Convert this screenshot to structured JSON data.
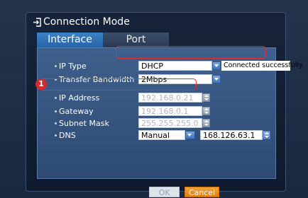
{
  "window": {
    "title": "Connection Mode",
    "title_icon": "login-arrow-icon"
  },
  "tabs": [
    {
      "label": "Interface",
      "active": true
    },
    {
      "label": "Port",
      "active": false
    }
  ],
  "form": {
    "ip_type": {
      "label": "IP Type",
      "value": "DHCP",
      "status": "Connected successfully."
    },
    "transfer_bandwidth": {
      "label": "Transfer Bandwidth",
      "value": "2Mbps"
    },
    "ip_address": {
      "label": "IP Address",
      "value": "192.168.0.21"
    },
    "gateway": {
      "label": "Gateway",
      "value": "192.168.0.1"
    },
    "subnet_mask": {
      "label": "Subnet Mask",
      "value": "255.255.255.0"
    },
    "dns": {
      "label": "DNS",
      "mode": "Manual",
      "value": "168.126.63.1"
    }
  },
  "annotation": {
    "step_number": "1"
  },
  "buttons": {
    "ok": "OK",
    "cancel": "Cancel"
  },
  "colors": {
    "highlight_outline": "#e0303a",
    "cancel_button": "#f08a1e",
    "active_tab": "#3178c0",
    "panel": "#3a5a86"
  }
}
